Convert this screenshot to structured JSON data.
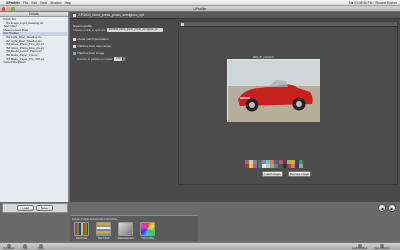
{
  "menubar": {
    "apple": "",
    "app_name": "i1Profiler",
    "menus": [
      "File",
      "Edit",
      "View",
      "Window",
      "Help"
    ],
    "clock": "Sat 03:08:36 PM",
    "user": "Simone Escher"
  },
  "window": {
    "title": "i1Profiler",
    "panel_title": "Patch Set"
  },
  "sidebar": {
    "header": "Details",
    "tree": [
      {
        "label": "Patch Set",
        "level": 1,
        "selected": false
      },
      {
        "label": "B1 Image_Light_Reading.txt",
        "level": 2,
        "selected": false
      },
      {
        "label": "Test Chart",
        "level": 1,
        "selected": false
      },
      {
        "label": "Measurement Data",
        "level": 1,
        "selected": false
      },
      {
        "label": "ICC Profiles",
        "level": 1,
        "selected": true
      },
      {
        "label": "B1 Light_Pixel_Reading.icc",
        "level": 2,
        "selected": false
      },
      {
        "label": "B2 Light_Pixel_Reading.icc",
        "level": 2,
        "selected": false
      },
      {
        "label": "B3 Gloss_Photo_Fine_Art.icc",
        "level": 2,
        "selected": false
      },
      {
        "label": "B4 Gloss_Photo_Fine_Art.icc",
        "level": 2,
        "selected": false
      },
      {
        "label": "B5 Media_Lustre_Paper.icc",
        "level": 2,
        "selected": false
      },
      {
        "label": "B6 Matte_Paper_Pro.icc",
        "level": 2,
        "selected": false
      },
      {
        "label": "B7 Matte_Paper_Pro_300.icc",
        "level": 2,
        "selected": false
      },
      {
        "label": "Saved Workflows",
        "level": 1,
        "selected": false
      }
    ]
  },
  "main": {
    "file_title": "EP3000_Ilford_press_photo_semigloss_opt",
    "settings": {
      "source_profile_label": "Source profile",
      "source_profile_hint": "Choose profile to optimize",
      "source_profile_value": "EP3000_Ilford_press_photo_semigloss_ts",
      "option1": "Reset patch generation",
      "option2": "Patches from tone ramps",
      "option3": "Patches from image",
      "num_label": "Number of patches to create",
      "num_value": "150"
    },
    "preview": {
      "image_label": "IMG_47_corvet.tif",
      "load_button": "Load Images",
      "remove_button": "Remove Image",
      "swatches": [
        "#9c6b5a",
        "#d6c9b9",
        "#7e8a9a",
        "#5e7446",
        "#8d85b0",
        "#7cbfb6",
        "#d6883a",
        "#4d61a5",
        "#c65a64",
        "#5b3a6a",
        "#9dbb4a",
        "#e2a437",
        "#2f3f8e",
        "#4f9a4c",
        "#b23a36",
        "#e8cf3a",
        "#b55aa0",
        "#2d83ad",
        "#f2f2f2",
        "#c9c9c9",
        "#a0a0a0",
        "#7a7a7a",
        "#555555",
        "#333333",
        "#b0413e",
        "#e07a5f",
        "#3d405b",
        "#81b29a"
      ]
    }
  },
  "bottom": {
    "load_button": "Load",
    "save_button": "Save",
    "workflow_title": "Printer Profile Optimization Workflow",
    "steps": [
      "Patch Set",
      "Test Chart",
      "Measurement",
      "ICC Profile"
    ]
  },
  "footer": {
    "left": [
      "Full Screen",
      "Help",
      "Home"
    ],
    "right": [
      "Load Workflow",
      "Save Workflow"
    ]
  },
  "colors": {
    "panel_dark": "#4a4a4a",
    "sidebar": "#e7ebf0",
    "car_red": "#c8201c"
  }
}
